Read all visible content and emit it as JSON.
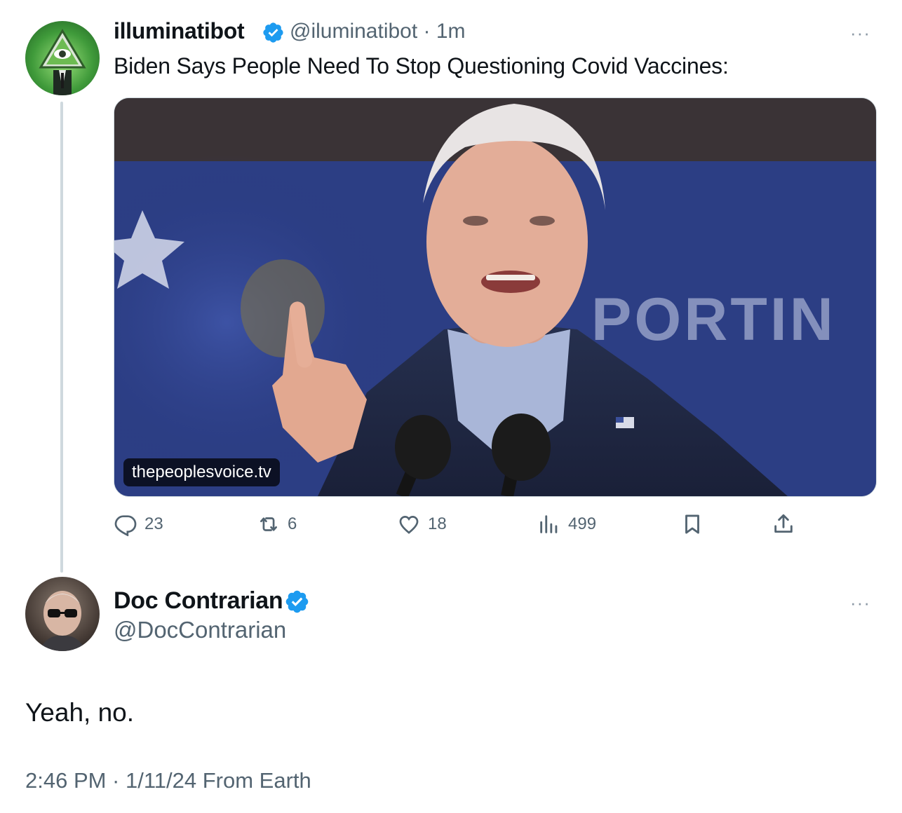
{
  "tweet1": {
    "display_name": "illuminatibot",
    "handle_time": "@iluminatibot · 1m",
    "text": "Biden Says People Need To Stop Questioning Covid Vaccines:",
    "more": "···",
    "media": {
      "source_label": "thepeoplesvoice.tv",
      "backdrop_text": "PORTIN"
    },
    "actions": {
      "replies": "23",
      "reposts": "6",
      "likes": "18",
      "views": "499"
    }
  },
  "tweet2": {
    "display_name": "Doc Contrarian",
    "handle": "@DocContrarian",
    "more": "···",
    "text": "Yeah, no.",
    "meta": "2:46 PM · 1/11/24 From Earth"
  },
  "colors": {
    "verified_blue": "#1d9bf0",
    "secondary_text": "#536471",
    "thread_line": "#cfd9de"
  },
  "icons": [
    "reply-icon",
    "repost-icon",
    "like-icon",
    "views-icon",
    "bookmark-icon",
    "share-icon",
    "verified-badge-icon",
    "more-icon"
  ]
}
